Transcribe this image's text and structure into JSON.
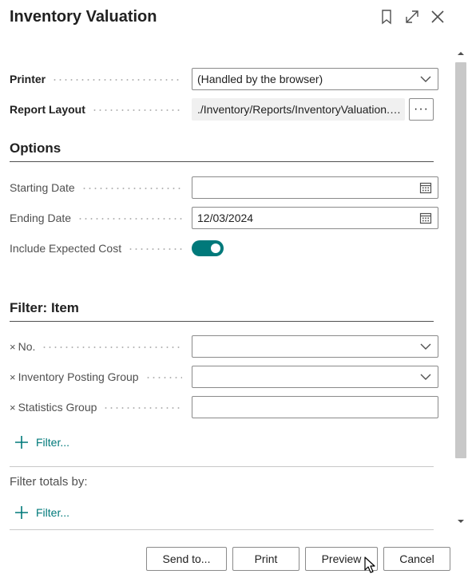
{
  "window": {
    "title": "Inventory Valuation"
  },
  "request_page": {
    "printer": {
      "label": "Printer",
      "value": "(Handled by the browser)"
    },
    "report_layout": {
      "label": "Report Layout",
      "value": "./Inventory/Reports/InventoryValuation.Rep...",
      "more_label": "···"
    },
    "options": {
      "heading": "Options",
      "starting_date": {
        "label": "Starting Date",
        "value": ""
      },
      "ending_date": {
        "label": "Ending Date",
        "value": "12/03/2024"
      },
      "include_expected_cost": {
        "label": "Include Expected Cost",
        "value": true
      }
    },
    "filter_item": {
      "heading": "Filter: Item",
      "fields": [
        {
          "remove": "×",
          "label": "No.",
          "value": ""
        },
        {
          "remove": "×",
          "label": "Inventory Posting Group",
          "value": ""
        },
        {
          "remove": "×",
          "label": "Statistics Group",
          "value": ""
        }
      ],
      "add_filter_label": "Filter..."
    },
    "filter_totals": {
      "label": "Filter totals by:",
      "add_filter_label": "Filter..."
    }
  },
  "footer": {
    "send_to": "Send to...",
    "print": "Print",
    "preview": "Preview",
    "cancel": "Cancel"
  },
  "colors": {
    "accent": "#00797a",
    "text": "#212121",
    "muted": "#505050",
    "border": "#8a8a8a"
  }
}
